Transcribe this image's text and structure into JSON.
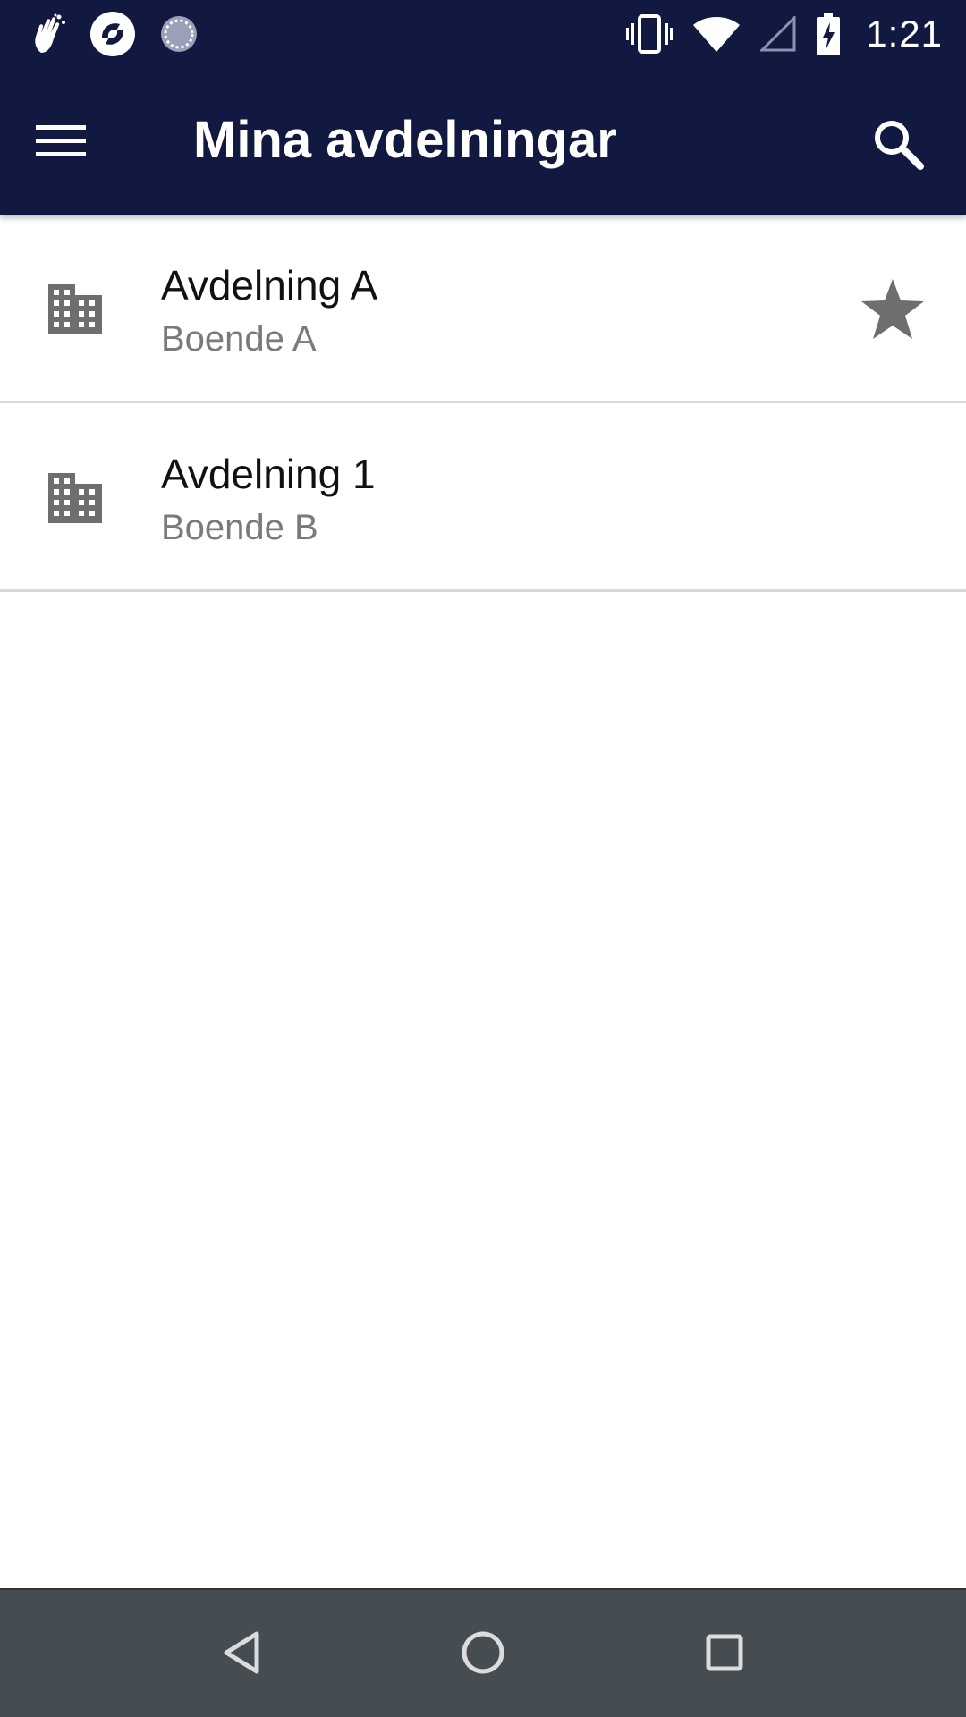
{
  "status_bar": {
    "time": "1:21",
    "left_icons": [
      "hand-wave-icon",
      "app-logo-icon",
      "sync-spinner-icon"
    ],
    "right_icons": [
      "vibrate-icon",
      "wifi-icon",
      "cellular-signal-icon",
      "battery-charging-icon"
    ]
  },
  "app_bar": {
    "title": "Mina avdelningar",
    "background_color": "#121940",
    "menu_icon": "hamburger-menu-icon",
    "search_icon": "search-icon"
  },
  "departments": [
    {
      "title": "Avdelning A",
      "subtitle": "Boende A",
      "icon": "building-icon",
      "favorite": true
    },
    {
      "title": "Avdelning 1",
      "subtitle": "Boende B",
      "icon": "building-icon",
      "favorite": false
    }
  ],
  "nav_bar": {
    "back_icon": "back-triangle-icon",
    "home_icon": "home-circle-icon",
    "recents_icon": "recents-square-icon"
  }
}
